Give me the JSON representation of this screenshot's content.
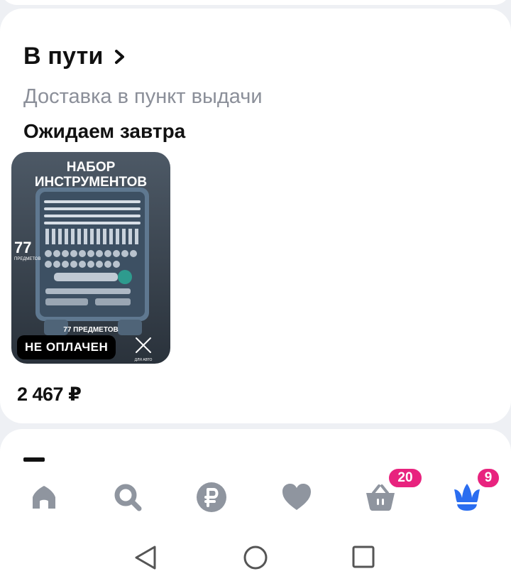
{
  "order": {
    "title": "В пути",
    "delivery_type": "Доставка в пункт выдачи",
    "status": "Ожидаем завтра",
    "product": {
      "image_caption_top_line1": "НАБОР",
      "image_caption_top_line2": "ИНСТРУМЕНТОВ",
      "image_count_big": "77",
      "image_count_small": "ПРЕДМЕТОВ",
      "image_case_label": "77 ПРЕДМЕТОВ",
      "image_corner_label": "ДЛЯ АВТО",
      "payment_badge": "НЕ ОПЛАЧЕН",
      "price": "2 467 ₽"
    }
  },
  "tabbar": {
    "items": [
      {
        "icon": "home-icon"
      },
      {
        "icon": "search-icon"
      },
      {
        "icon": "ruble-icon"
      },
      {
        "icon": "heart-icon"
      },
      {
        "icon": "basket-icon",
        "badge": "20"
      },
      {
        "icon": "crown-icon",
        "badge": "9"
      }
    ]
  },
  "system_nav": {
    "icons": [
      "back-icon",
      "home-circle-icon",
      "recents-icon"
    ]
  },
  "colors": {
    "accent_pink": "#e8237e",
    "active_blue": "#2a6df0",
    "inactive_icon": "#8f959f",
    "muted_text": "#8b8f99"
  }
}
